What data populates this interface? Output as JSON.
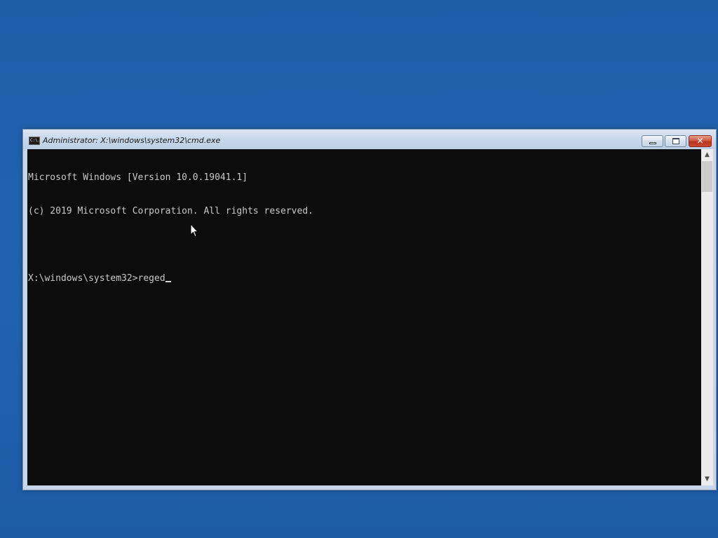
{
  "window": {
    "title": "Administrator: X:\\windows\\system32\\cmd.exe",
    "icon": "cmd-icon",
    "icon_text": "C:\\.",
    "controls": {
      "minimize": "minimize-icon",
      "maximize": "restore-icon",
      "close": "close-icon",
      "close_glyph": "✕"
    }
  },
  "console": {
    "lines": [
      "Microsoft Windows [Version 10.0.19041.1]",
      "(c) 2019 Microsoft Corporation. All rights reserved.",
      "",
      "X:\\windows\\system32>reged"
    ],
    "cursor": "blinking-underscore"
  },
  "scrollbar": {
    "up_arrow": "▲",
    "down_arrow": "▼"
  },
  "colors": {
    "desktop_background": "#1f5fac",
    "console_background": "#0c0c0c",
    "console_text": "#c8c8c8",
    "close_button": "#c9492f"
  }
}
